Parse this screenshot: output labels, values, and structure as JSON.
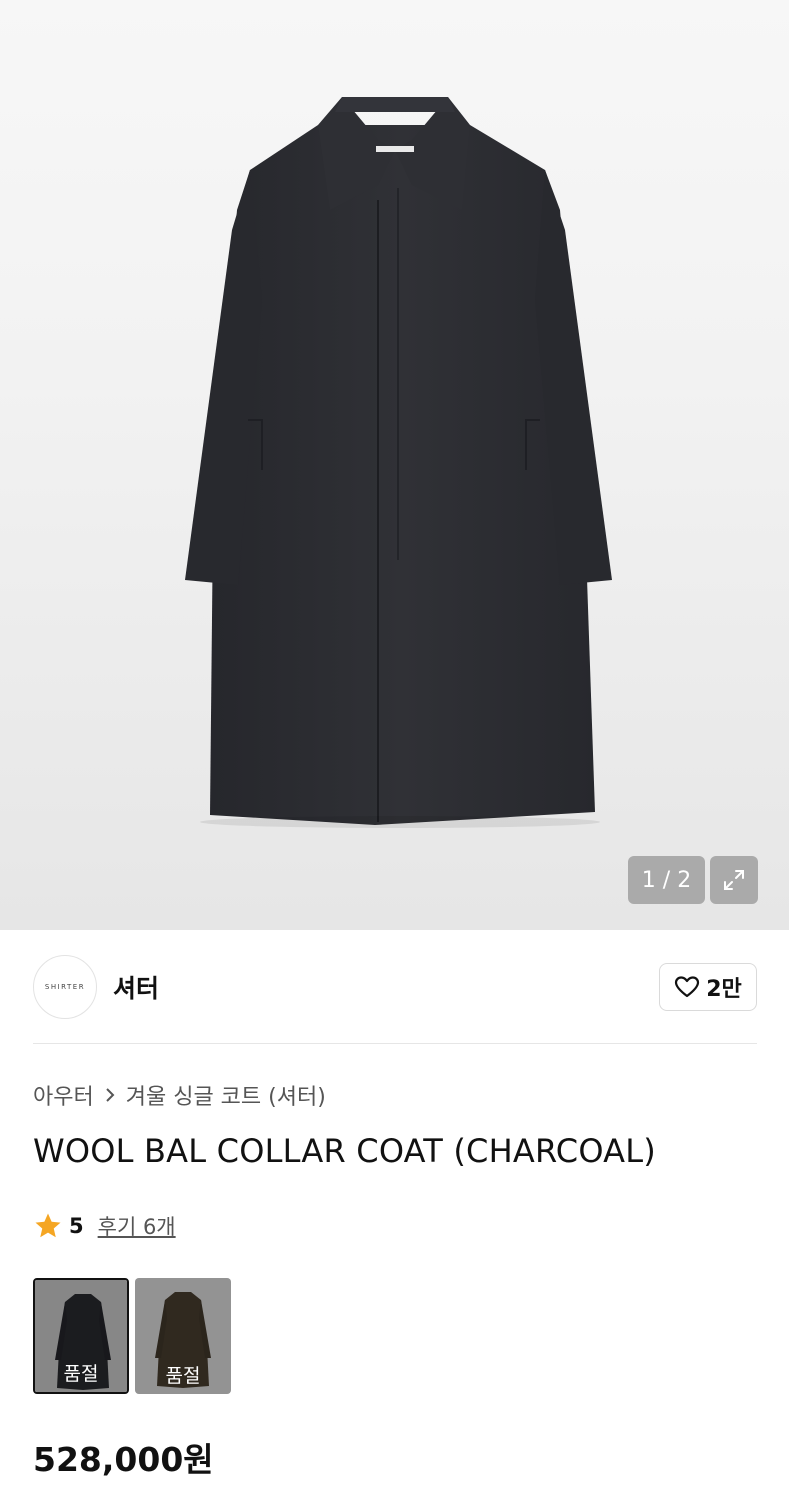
{
  "gallery": {
    "counter": "1 / 2",
    "image_label": "SHIRTER"
  },
  "brand": {
    "logo_text": "SHIRTER",
    "name": "셔터",
    "likes": "2만"
  },
  "breadcrumb": {
    "category": "아우터",
    "subcategory": "겨울 싱글 코트 (셔터)"
  },
  "product": {
    "title": "WOOL BAL COLLAR COAT (CHARCOAL)",
    "rating": "5",
    "reviews": "후기 6개",
    "price": "528,000원"
  },
  "swatches": [
    {
      "label": "품절",
      "color": "#2a2b30"
    },
    {
      "label": "품절",
      "color": "#4a3f30"
    }
  ],
  "colors": {
    "star": "#f5a623",
    "coat": "#2b2c31"
  }
}
